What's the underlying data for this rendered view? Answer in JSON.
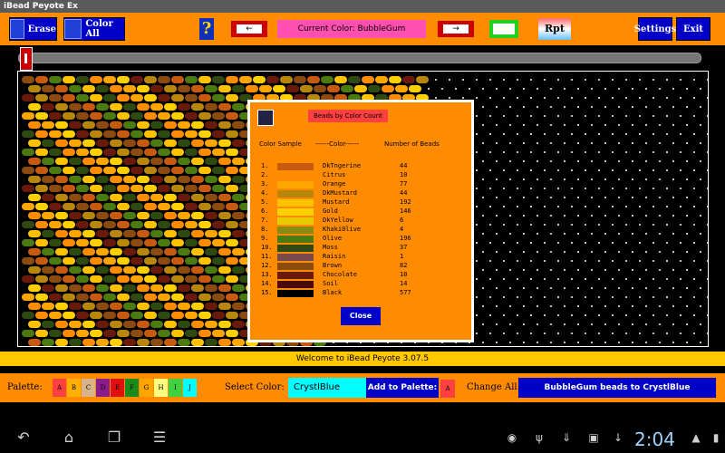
{
  "window": {
    "title": "iBead Peyote Ex"
  },
  "toolbar": {
    "erase_label": "Erase",
    "color_all_label": "Color All",
    "help_label": "?",
    "current_color_text": "Current Color:  BubbleGum",
    "rpt_label": "Rpt",
    "settings_label": "Settings",
    "exit_label": "Exit"
  },
  "status": {
    "message": "Welcome to iBead Peyote 3.07.5"
  },
  "palette": {
    "label": "Palette:",
    "swatches": [
      {
        "letter": "A",
        "color": "#ff4040"
      },
      {
        "letter": "B",
        "color": "#ffb000"
      },
      {
        "letter": "C",
        "color": "#d8b48a"
      },
      {
        "letter": "D",
        "color": "#8b1a8b"
      },
      {
        "letter": "E",
        "color": "#e01010"
      },
      {
        "letter": "F",
        "color": "#1a8a1a"
      },
      {
        "letter": "G",
        "color": "#ffa500"
      },
      {
        "letter": "H",
        "color": "#ffff80"
      },
      {
        "letter": "I",
        "color": "#40d040"
      },
      {
        "letter": "J",
        "color": "#00ffff"
      }
    ]
  },
  "select_color": {
    "label": "Select Color:",
    "value": "CrystlBlue"
  },
  "add_to_palette": {
    "label": "Add to Palette:",
    "swatch_letter": "A"
  },
  "change_all": {
    "label": "Change All:",
    "button_label": "BubbleGum beads to CrystlBlue"
  },
  "dialog": {
    "title": "Beads by Color Count",
    "col_sample": "Color Sample",
    "col_color": "------Color------",
    "col_count": "Number of Beads",
    "close_label": "Close",
    "rows": [
      {
        "n": "1.",
        "name": "DkTngerine",
        "count": "44",
        "color": "#c85a10"
      },
      {
        "n": "2.",
        "name": "Citrus",
        "count": "10",
        "color": "#ff8c00"
      },
      {
        "n": "3.",
        "name": "Orange",
        "count": "77",
        "color": "#ffa500"
      },
      {
        "n": "4.",
        "name": "DkMustard",
        "count": "44",
        "color": "#b8860b"
      },
      {
        "n": "5.",
        "name": "Mustard",
        "count": "192",
        "color": "#ffc200"
      },
      {
        "n": "6.",
        "name": "Gold",
        "count": "146",
        "color": "#ffd000"
      },
      {
        "n": "7.",
        "name": "DkYellow",
        "count": "6",
        "color": "#e8c800"
      },
      {
        "n": "8.",
        "name": "Khaki0live",
        "count": "4",
        "color": "#8a8a10"
      },
      {
        "n": "9.",
        "name": "Olive",
        "count": "196",
        "color": "#4a7a10"
      },
      {
        "n": "10.",
        "name": "Moss",
        "count": "37",
        "color": "#2f4a10"
      },
      {
        "n": "11.",
        "name": "Raisin",
        "count": "1",
        "color": "#7a4a4a"
      },
      {
        "n": "12.",
        "name": "Brown",
        "count": "82",
        "color": "#8a4a10"
      },
      {
        "n": "13.",
        "name": "Chocolate",
        "count": "10",
        "color": "#6a1a0a"
      },
      {
        "n": "14.",
        "name": "Soil",
        "count": "14",
        "color": "#4a0a0a"
      },
      {
        "n": "15.",
        "name": "Black",
        "count": "577",
        "color": "#000000"
      }
    ]
  },
  "system": {
    "time": "2:04"
  }
}
